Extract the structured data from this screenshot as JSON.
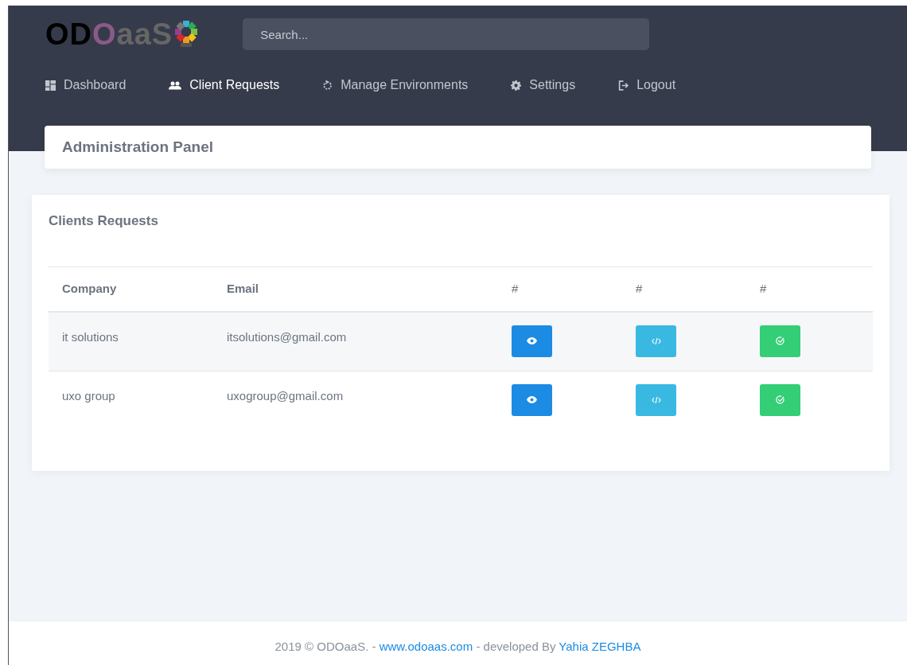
{
  "logo": {
    "parts": [
      {
        "text": "OD",
        "color": "#000000"
      },
      {
        "text": "O",
        "color": "#8a5a86"
      },
      {
        "text": "aaS",
        "color": "#666666"
      }
    ]
  },
  "search": {
    "placeholder": "Search..."
  },
  "nav": [
    {
      "label": "Dashboard",
      "selected": false
    },
    {
      "label": "Client Requests",
      "selected": true
    },
    {
      "label": "Manage Environments",
      "selected": false
    },
    {
      "label": "Settings",
      "selected": false
    },
    {
      "label": "Logout",
      "selected": false
    }
  ],
  "page_title": "Administration Panel",
  "card": {
    "title": "Clients Requests",
    "table": {
      "columns": [
        "Company",
        "Email",
        "#",
        "#",
        "#"
      ],
      "rows": [
        {
          "company": "it solutions",
          "email": "itsolutions@gmail.com",
          "actions": [
            {
              "kind": "view"
            },
            {
              "kind": "code"
            },
            {
              "kind": "approve"
            }
          ]
        },
        {
          "company": "uxo group",
          "email": "uxogroup@gmail.com",
          "actions": [
            {
              "kind": "view"
            },
            {
              "kind": "code"
            },
            {
              "kind": "approve"
            }
          ]
        }
      ]
    }
  },
  "footer": {
    "parts": [
      {
        "kind": "text",
        "text": "2019 © ODOaaS. - "
      },
      {
        "kind": "link",
        "text": "www.odoaas.com"
      },
      {
        "kind": "text",
        "text": " - developed By "
      },
      {
        "kind": "link",
        "text": "Yahia ZEGHBA"
      }
    ]
  }
}
